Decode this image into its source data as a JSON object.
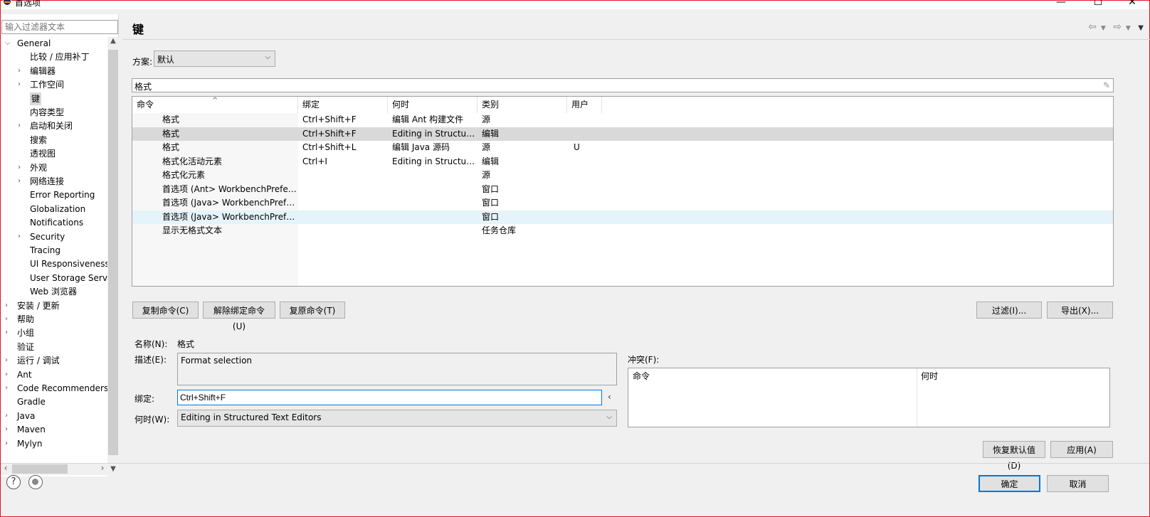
{
  "window": {
    "title": "首选项",
    "minimize": "—",
    "maximize": "☐",
    "close": "✕"
  },
  "left": {
    "filter_placeholder": "输入过滤器文本",
    "tree": [
      {
        "label": "General",
        "level": 0,
        "twisty": "expanded"
      },
      {
        "label": "比较 / 应用补丁",
        "level": 1,
        "twisty": "none"
      },
      {
        "label": "编辑器",
        "level": 1,
        "twisty": "collapsed"
      },
      {
        "label": "工作空间",
        "level": 1,
        "twisty": "collapsed"
      },
      {
        "label": "键",
        "level": 1,
        "twisty": "none",
        "selected": true
      },
      {
        "label": "内容类型",
        "level": 1,
        "twisty": "none"
      },
      {
        "label": "启动和关闭",
        "level": 1,
        "twisty": "collapsed"
      },
      {
        "label": "搜索",
        "level": 1,
        "twisty": "none"
      },
      {
        "label": "透视图",
        "level": 1,
        "twisty": "none"
      },
      {
        "label": "外观",
        "level": 1,
        "twisty": "collapsed"
      },
      {
        "label": "网络连接",
        "level": 1,
        "twisty": "collapsed"
      },
      {
        "label": "Error Reporting",
        "level": 1,
        "twisty": "none"
      },
      {
        "label": "Globalization",
        "level": 1,
        "twisty": "none"
      },
      {
        "label": "Notifications",
        "level": 1,
        "twisty": "none"
      },
      {
        "label": "Security",
        "level": 1,
        "twisty": "collapsed"
      },
      {
        "label": "Tracing",
        "level": 1,
        "twisty": "none"
      },
      {
        "label": "UI Responsiveness",
        "level": 1,
        "twisty": "none"
      },
      {
        "label": "User Storage Serv",
        "level": 1,
        "twisty": "none"
      },
      {
        "label": "Web 浏览器",
        "level": 1,
        "twisty": "none"
      },
      {
        "label": "安装 / 更新",
        "level": 0,
        "twisty": "collapsed"
      },
      {
        "label": "帮助",
        "level": 0,
        "twisty": "collapsed"
      },
      {
        "label": "小组",
        "level": 0,
        "twisty": "collapsed"
      },
      {
        "label": "验证",
        "level": 0,
        "twisty": "none"
      },
      {
        "label": "运行 / 调试",
        "level": 0,
        "twisty": "collapsed"
      },
      {
        "label": "Ant",
        "level": 0,
        "twisty": "collapsed"
      },
      {
        "label": "Code Recommenders",
        "level": 0,
        "twisty": "collapsed"
      },
      {
        "label": "Gradle",
        "level": 0,
        "twisty": "none"
      },
      {
        "label": "Java",
        "level": 0,
        "twisty": "collapsed"
      },
      {
        "label": "Maven",
        "level": 0,
        "twisty": "collapsed"
      },
      {
        "label": "Mylyn",
        "level": 0,
        "twisty": "collapsed"
      }
    ]
  },
  "main": {
    "title": "键",
    "scheme_label": "方案:",
    "scheme_value": "默认",
    "search_value": "格式",
    "columns": [
      "命令",
      "绑定",
      "何时",
      "类别",
      "用户"
    ],
    "rows": [
      {
        "command": "格式",
        "binding": "Ctrl+Shift+F",
        "when": "编辑 Ant 构建文件",
        "category": "源",
        "user": ""
      },
      {
        "command": "格式",
        "binding": "Ctrl+Shift+F",
        "when": "Editing in Structure...",
        "category": "编辑",
        "user": "",
        "selected": true
      },
      {
        "command": "格式",
        "binding": "Ctrl+Shift+L",
        "when": "编辑 Java 源码",
        "category": "源",
        "user": "U"
      },
      {
        "command": "格式化活动元素",
        "binding": "Ctrl+I",
        "when": "Editing in Structure...",
        "category": "编辑",
        "user": ""
      },
      {
        "command": "格式化元素",
        "binding": "",
        "when": "",
        "category": "源",
        "user": ""
      },
      {
        "command": "首选项 (Ant> WorkbenchPreferenc",
        "binding": "",
        "when": "",
        "category": "窗口",
        "user": ""
      },
      {
        "command": "首选项 (Java> WorkbenchPreferen",
        "binding": "",
        "when": "",
        "category": "窗口",
        "user": ""
      },
      {
        "command": "首选项 (Java> WorkbenchPreferen",
        "binding": "",
        "when": "",
        "category": "窗口",
        "user": "",
        "hover": true
      },
      {
        "command": "显示无格式文本",
        "binding": "",
        "when": "",
        "category": "任务仓库",
        "user": ""
      }
    ],
    "buttons": {
      "copy": "复制命令(C)",
      "unbind": "解除绑定命令(U)",
      "restore": "复原命令(T)",
      "filter": "过滤(I)...",
      "export": "导出(X)..."
    },
    "details": {
      "name_label": "名称(N):",
      "name_value": "格式",
      "desc_label": "描述(E):",
      "desc_value": "Format selection",
      "binding_label": "绑定:",
      "binding_value": "Ctrl+Shift+F",
      "when_label": "何时(W):",
      "when_value": "Editing in Structured Text Editors",
      "conflicts_label": "冲突(F):",
      "conflict_columns": [
        "命令",
        "何时"
      ]
    },
    "restore_defaults": "恢复默认值(D)",
    "apply": "应用(A)"
  },
  "footer": {
    "ok": "确定",
    "cancel": "取消"
  }
}
